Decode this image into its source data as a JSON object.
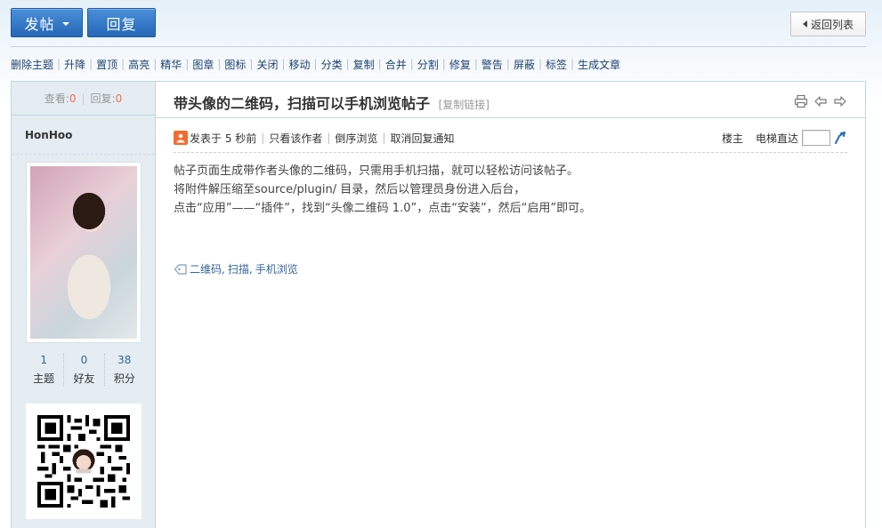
{
  "toolbar": {
    "post_label": "发帖",
    "reply_label": "回复",
    "back_label": "返回列表"
  },
  "admin_tools": [
    "删除主题",
    "升降",
    "置顶",
    "高亮",
    "精华",
    "图章",
    "图标",
    "关闭",
    "移动",
    "分类",
    "复制",
    "合并",
    "分割",
    "修复",
    "警告",
    "屏蔽",
    "标签",
    "生成文章"
  ],
  "sidebar": {
    "views_label": "查看:",
    "views_value": "0",
    "replies_label": "回复:",
    "replies_value": "0",
    "author": "HonHoo",
    "stats": [
      {
        "value": "1",
        "label": "主题"
      },
      {
        "value": "0",
        "label": "好友"
      },
      {
        "value": "38",
        "label": "积分"
      }
    ]
  },
  "post": {
    "title": "带头像的二维码，扫描可以手机浏览帖子",
    "copy_link": "[复制链接]",
    "posted_time": "发表于 5 秒前",
    "only_author": "只看该作者",
    "reverse_order": "倒序浏览",
    "cancel_notify": "取消回复通知",
    "floor": "楼主",
    "elevator": "电梯直达",
    "body_lines": [
      "帖子页面生成带作者头像的二维码，只需用手机扫描，就可以轻松访问该帖子。",
      "将附件解压缩至source/plugin/ 目录，然后以管理员身份进入后台，",
      "点击“应用”——“插件”，找到“头像二维码 1.0”，点击“安装”，然后“启用”即可。"
    ],
    "tags": [
      "二维码",
      "扫描",
      "手机浏览"
    ]
  },
  "icons": {
    "print": "printer-icon",
    "prev": "prev-thread-icon",
    "next": "next-thread-icon",
    "tag": "tag-icon",
    "go": "go-arrow-icon"
  },
  "colors": {
    "primary_button": "#2a6bb9",
    "link": "#336699",
    "highlight_number": "#f26c4f",
    "sidebar_bg": "#e5edf2",
    "border": "#c2d5e3"
  }
}
